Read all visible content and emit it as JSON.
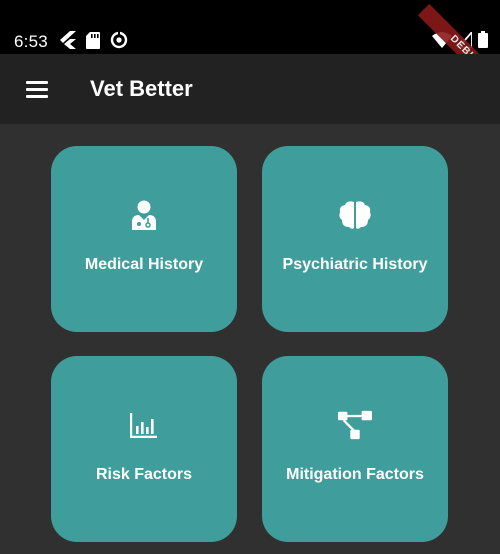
{
  "status_bar": {
    "time": "6:53",
    "left_icons": [
      "flutter-icon",
      "sd-card-icon",
      "data-saver-icon"
    ],
    "right_icons": [
      "wifi-icon",
      "signal-icon",
      "battery-icon"
    ],
    "debug_label": "DEBUG"
  },
  "app_bar": {
    "title": "Vet Better",
    "menu_icon": "menu-icon"
  },
  "tiles": [
    {
      "label": "Medical History",
      "icon": "doctor-icon"
    },
    {
      "label": "Psychiatric History",
      "icon": "brain-icon"
    },
    {
      "label": "Risk Factors",
      "icon": "chart-bars-icon"
    },
    {
      "label": "Mitigation Factors",
      "icon": "flow-diagram-icon"
    }
  ],
  "colors": {
    "tile": "#3f9e9b",
    "background": "#303030",
    "app_bar": "#222222"
  }
}
